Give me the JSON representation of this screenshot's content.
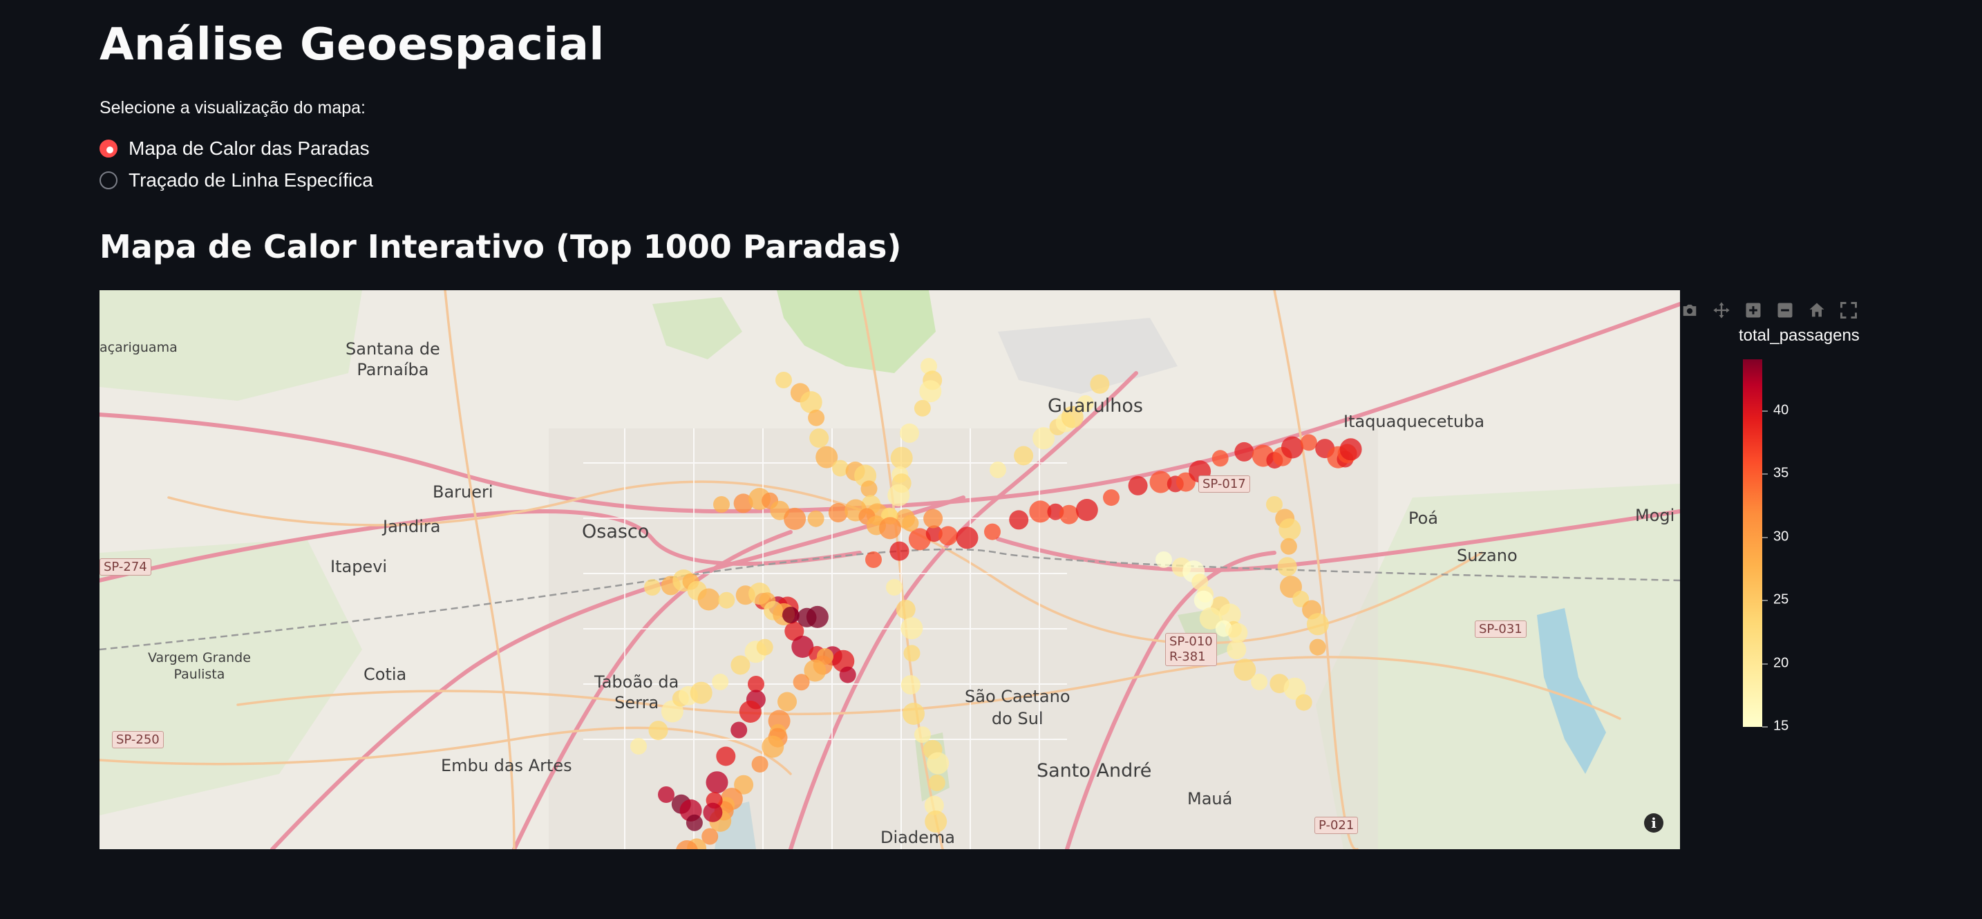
{
  "page": {
    "title": "Análise Geoespacial",
    "radio_caption": "Selecione a visualização do mapa:",
    "radio_options": [
      "Mapa de Calor das Paradas",
      "Traçado de Linha Específica"
    ],
    "selected_option": "Mapa de Calor das Paradas",
    "section_title": "Mapa de Calor Interativo (Top 1000 Paradas)"
  },
  "map": {
    "places": {
      "guarulhos": "Guarulhos",
      "itaquaquecetuba": "Itaquaquecetuba",
      "santana": "Santana de\nParnaíba",
      "barueri": "Barueri",
      "jandira": "Jandira",
      "osasco": "Osasco",
      "itapevi": "Itapevi",
      "poa": "Poá",
      "suzano": "Suzano",
      "mogi": "Mogi",
      "vargem": "Vargem Grande\nPaulista",
      "cotia": "Cotia",
      "taboao": "Taboão da\nSerra",
      "sao_caetano": "São Caetano\ndo Sul",
      "santo_andre": "Santo André",
      "maua": "Mauá",
      "embu": "Embu das Artes",
      "diadema": "Diadema",
      "acariguama": "açariguama"
    },
    "shields": {
      "sp274": "SP-274",
      "sp017": "SP-017",
      "sp010": "SP-010\nR-381",
      "sp031": "SP-031",
      "sp250": "SP-250",
      "sp021": "P-021"
    },
    "info_icon": "info-icon"
  },
  "modebar": {
    "icons": [
      "camera-icon",
      "pan-icon",
      "zoom-in-icon",
      "zoom-out-icon",
      "home-icon",
      "fullscreen-icon"
    ]
  },
  "colorbar": {
    "title": "total_passagens",
    "ticks": [
      "40",
      "35",
      "30",
      "25",
      "20",
      "15"
    ],
    "range": [
      15,
      44
    ],
    "colorscale": [
      "#ffffcc",
      "#ffeda0",
      "#fed976",
      "#feb24c",
      "#fd8d3c",
      "#fc4e2a",
      "#e31a1c",
      "#bd0026",
      "#800026"
    ]
  }
}
